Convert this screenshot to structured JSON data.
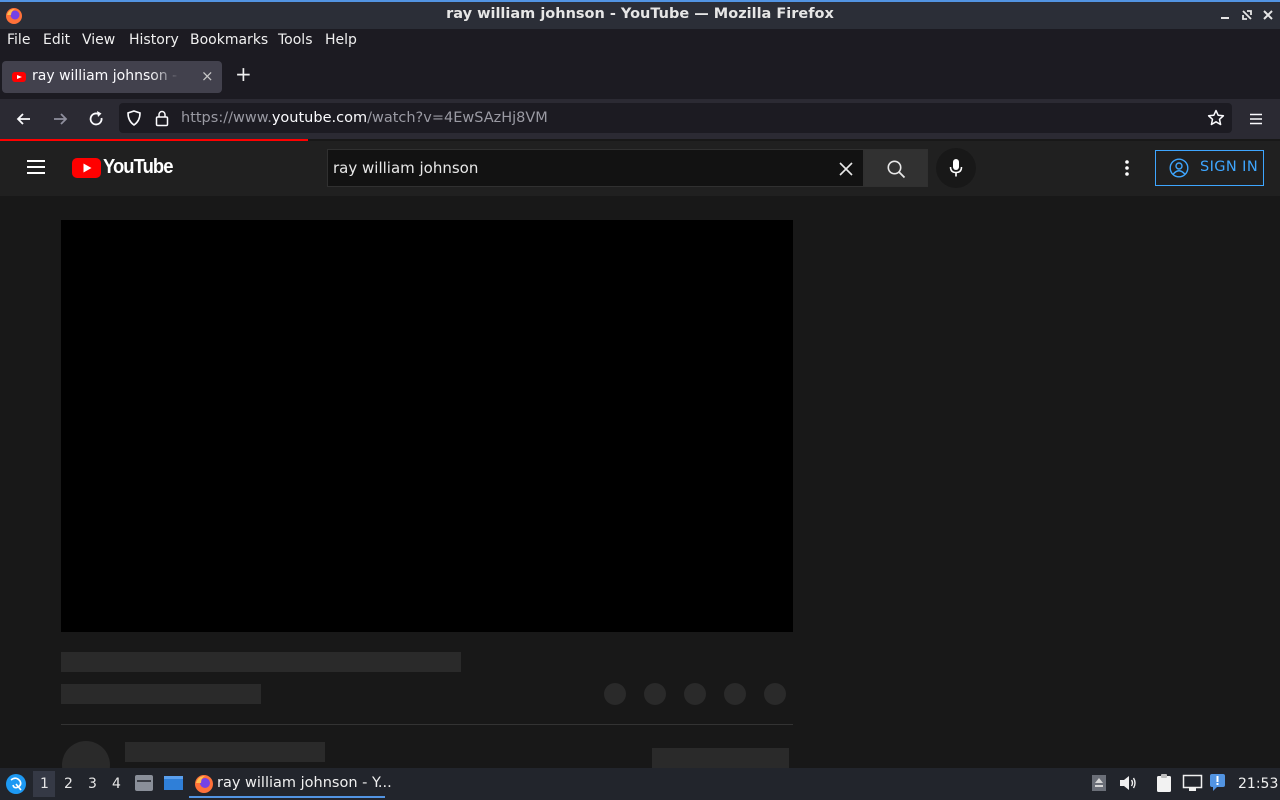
{
  "window": {
    "title": "ray william johnson - YouTube — Mozilla Firefox"
  },
  "menubar": {
    "items": [
      "File",
      "Edit",
      "View",
      "History",
      "Bookmarks",
      "Tools",
      "Help"
    ]
  },
  "tab": {
    "title": "ray william johnson - YouTube",
    "close_glyph": "×",
    "new_tab_glyph": "+"
  },
  "navbar": {
    "url_prefix": "https://www.",
    "url_host": "youtube.com",
    "url_path": "/watch?v=4EwSAzHj8VM"
  },
  "youtube": {
    "logo_text": "YouTube",
    "search_value": "ray william johnson",
    "signin_label": "SIGN IN",
    "accent_red": "#ff0000",
    "accent_blue": "#3ea6ff"
  },
  "taskbar": {
    "workspaces": [
      "1",
      "2",
      "3",
      "4"
    ],
    "active_workspace": "1",
    "task_title": "ray william johnson - Y...",
    "clock": "21:53"
  },
  "icons": [
    "firefox-icon",
    "minimize-icon",
    "restore-icon",
    "close-icon",
    "back-icon",
    "forward-icon",
    "reload-icon",
    "shield-icon",
    "lock-icon",
    "bookmark-star-icon",
    "hamburger-menu-icon",
    "youtube-logo-icon",
    "clear-search-icon",
    "search-icon",
    "microphone-icon",
    "more-vert-icon",
    "account-icon",
    "start-menu-icon",
    "file-manager-icon",
    "desktop-icon",
    "volume-icon",
    "clipboard-icon",
    "network-icon",
    "notification-icon"
  ]
}
